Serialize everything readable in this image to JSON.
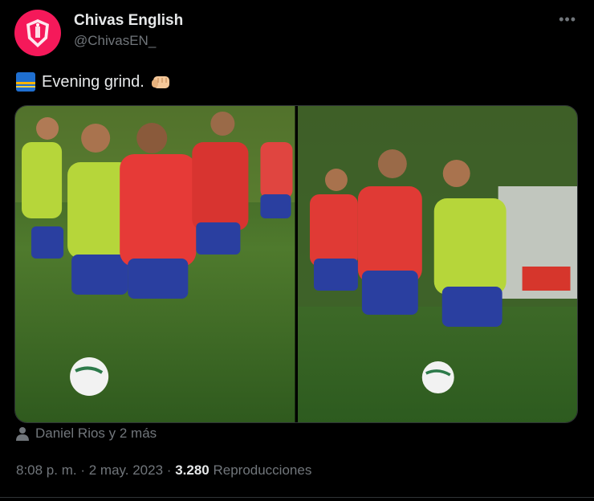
{
  "author": {
    "name": "Chivas English",
    "handle": "@ChivasEN_"
  },
  "tweet": {
    "emoji_start": "sunrise-emoji",
    "text": "Evening grind.",
    "emoji_end": "fist-emoji"
  },
  "media": {
    "photos": [
      "photo-left",
      "photo-right"
    ]
  },
  "tagged": {
    "text": "Daniel Rios y 2 más"
  },
  "meta": {
    "time": "8:08 p. m.",
    "sep": "·",
    "date": "2 may. 2023",
    "views_count": "3.280",
    "views_label": "Reproducciones"
  },
  "colors": {
    "brand": "#f5195a",
    "muted": "#71767b",
    "text": "#e7e9ea"
  }
}
